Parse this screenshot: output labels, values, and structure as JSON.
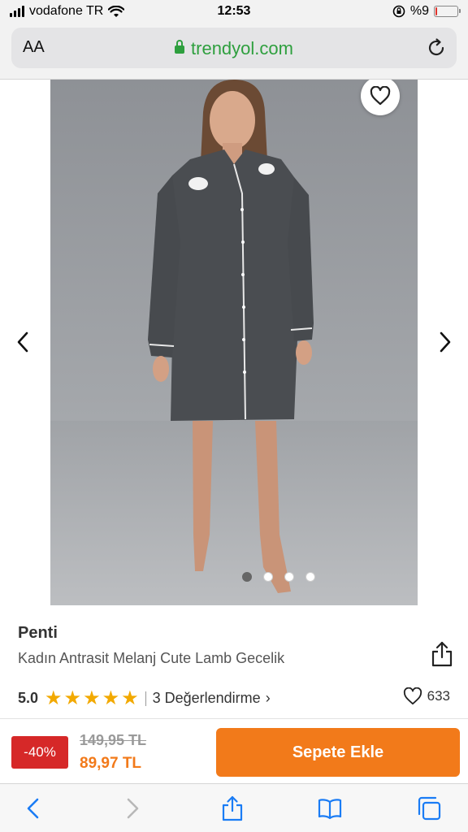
{
  "status_bar": {
    "carrier": "vodafone TR",
    "time": "12:53",
    "battery": "%9",
    "battery_level": 0.09
  },
  "browser": {
    "text_size_label": "AA",
    "url": "trendyol.com"
  },
  "gallery": {
    "image_count": 4,
    "active_index": 0
  },
  "product": {
    "brand": "Penti",
    "name": "Kadın Antrasit Melanj Cute Lamb Gecelik",
    "rating": "5.0",
    "star_count": 5,
    "reviews_label": "3 Değerlendirme",
    "likes": "633"
  },
  "purchase": {
    "discount": "-40%",
    "old_price": "149,95 TL",
    "new_price": "89,97 TL",
    "add_to_cart": "Sepete Ekle"
  },
  "colors": {
    "brand_orange": "#f27a1a",
    "discount_red": "#d62828",
    "star_gold": "#f2a900",
    "secure_green": "#2e9f3e",
    "ios_blue": "#1a7cf5"
  }
}
